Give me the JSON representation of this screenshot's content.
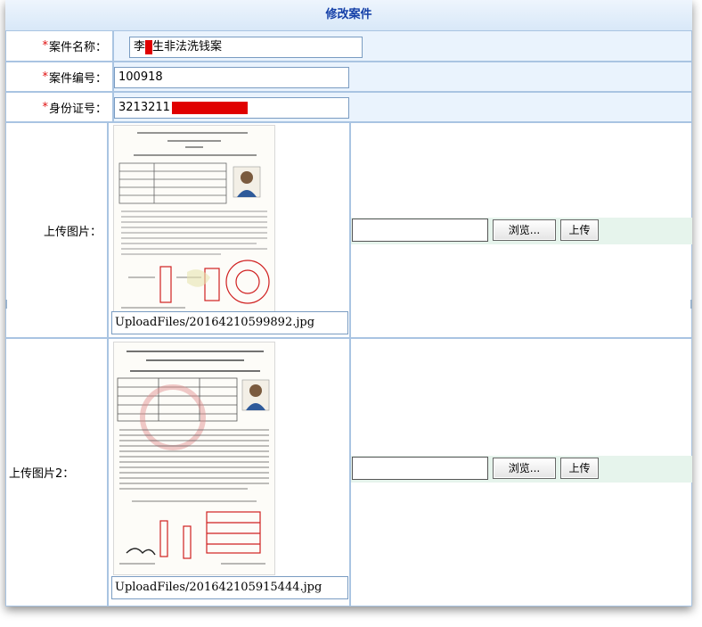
{
  "form": {
    "title": "修改案件",
    "required_mark": "*",
    "fields": {
      "case_name": {
        "label": "案件名称：",
        "value": "李",
        "value_after": "生非法洗钱案"
      },
      "case_number": {
        "label": "案件编号：",
        "value": "100918"
      },
      "id_number": {
        "label": "身份证号：",
        "value": "3213211"
      }
    },
    "uploads": [
      {
        "label": "上传图片：",
        "path": "UploadFiles/20164210599892.jpg",
        "browse_label": "浏览...",
        "upload_label": "上传"
      },
      {
        "label": "上传图片2：",
        "path": "UploadFiles/20164210591544​4.jpg",
        "browse_label": "浏览...",
        "upload_label": "上传"
      }
    ]
  },
  "colors": {
    "title_text": "#1540a8",
    "border": "#a9c4e2",
    "value_bg": "#eaf3fd",
    "required": "#e01010",
    "redaction": "#e00000",
    "upload_strip": "#e6f4ec"
  }
}
